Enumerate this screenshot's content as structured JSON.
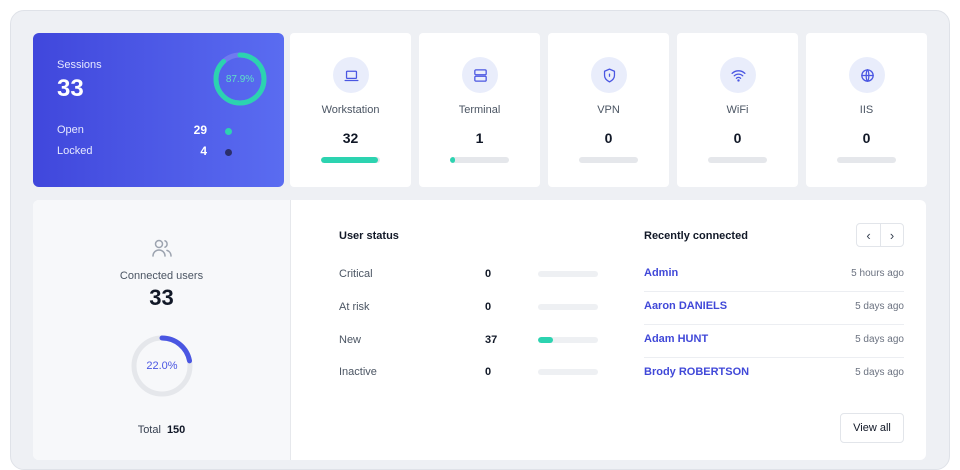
{
  "colors": {
    "accent": "#4a56e2",
    "teal": "#2cd3b0",
    "dark_dot": "#2b2f6b"
  },
  "sessions": {
    "title": "Sessions",
    "count": "33",
    "percent_label": "87.9%",
    "percent": 0.879,
    "rows": [
      {
        "label": "Open",
        "value": "29",
        "dot_color": "#2cd3b0"
      },
      {
        "label": "Locked",
        "value": "4",
        "dot_color": "#2b2f6b"
      }
    ]
  },
  "types": [
    {
      "name": "Workstation",
      "value": "32",
      "fill": 0.97,
      "icon": "laptop-icon"
    },
    {
      "name": "Terminal",
      "value": "1",
      "fill": 0.09,
      "icon": "server-icon"
    },
    {
      "name": "VPN",
      "value": "0",
      "fill": 0,
      "icon": "shield-icon"
    },
    {
      "name": "WiFi",
      "value": "0",
      "fill": 0,
      "icon": "wifi-icon"
    },
    {
      "name": "IIS",
      "value": "0",
      "fill": 0,
      "icon": "globe-icon"
    }
  ],
  "connected_users": {
    "label": "Connected users",
    "count": "33",
    "percent_label": "22.0%",
    "percent": 0.22,
    "total_label": "Total",
    "total_value": "150"
  },
  "user_status": {
    "title": "User status",
    "rows": [
      {
        "label": "Critical",
        "value": "0",
        "fill": 0
      },
      {
        "label": "At risk",
        "value": "0",
        "fill": 0
      },
      {
        "label": "New",
        "value": "37",
        "fill": 0.25
      },
      {
        "label": "Inactive",
        "value": "0",
        "fill": 0
      }
    ]
  },
  "recent": {
    "title": "Recently connected",
    "prev_symbol": "‹",
    "next_symbol": "›",
    "items": [
      {
        "name": "Admin",
        "when": "5 hours ago"
      },
      {
        "name": "Aaron DANIELS",
        "when": "5 days ago"
      },
      {
        "name": "Adam HUNT",
        "when": "5 days ago"
      },
      {
        "name": "Brody ROBERTSON",
        "when": "5 days ago"
      }
    ],
    "view_all": "View all"
  }
}
